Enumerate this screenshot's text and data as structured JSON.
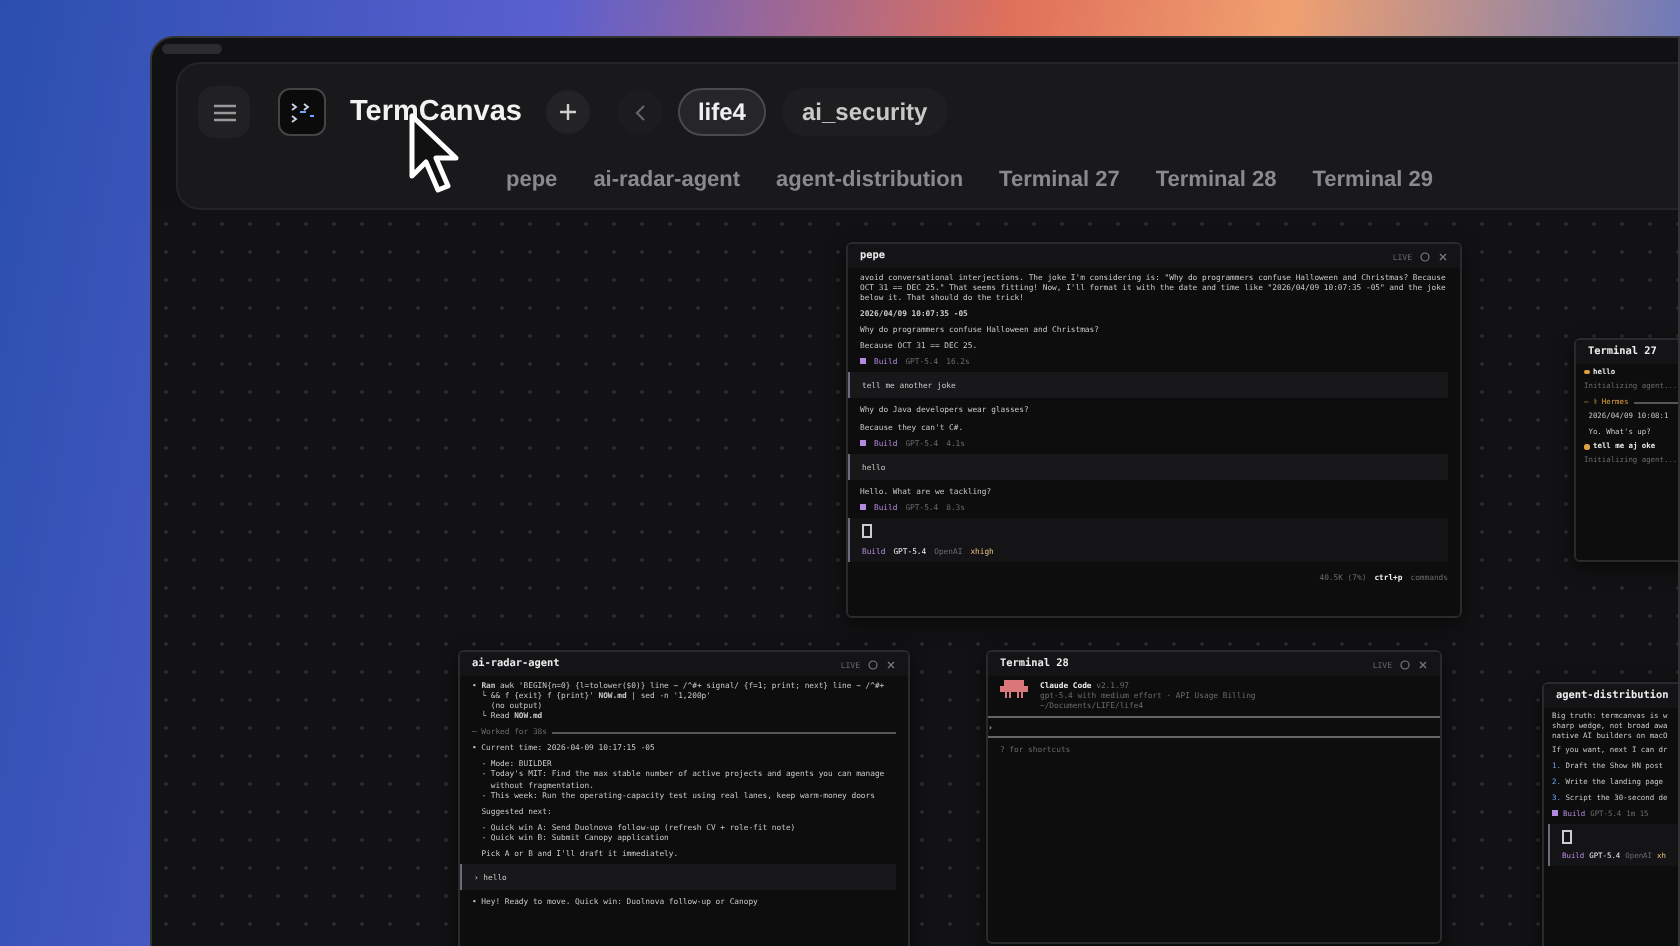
{
  "app": {
    "title": "TermCanvas"
  },
  "projects": [
    {
      "label": "life4",
      "selected": true
    },
    {
      "label": "ai_security",
      "selected": false
    }
  ],
  "terminal_tabs": [
    "pepe",
    "ai-radar-agent",
    "agent-distribution",
    "Terminal 27",
    "Terminal 28",
    "Terminal 29"
  ],
  "terminals": [
    {
      "title": "pepe",
      "status": "LIVE",
      "lines": [
        {
          "kind": "text",
          "text": "avoid conversational interjections. The joke I'm considering is: \"Why do programmers confuse Halloween and Christmas? Because OCT 31 == DEC 25.\" That seems fitting! Now, I'll format it with the date and time like \"2026/04/09 10:07:35 -05\" and the joke below it. That should do the trick!"
        },
        {
          "kind": "bold",
          "text": "2026/04/09 10:07:35 -05"
        },
        {
          "kind": "text",
          "text": "Why do programmers confuse Halloween and Christmas?"
        },
        {
          "kind": "text",
          "text": "Because OCT 31 == DEC 25."
        },
        {
          "kind": "meta",
          "mode": "Build",
          "model": "GPT-5.4",
          "time": "16.2s"
        },
        {
          "kind": "user",
          "text": "tell me another joke"
        },
        {
          "kind": "text",
          "text": "Why do Java developers wear glasses?"
        },
        {
          "kind": "text",
          "text": "Because they can't C#."
        },
        {
          "kind": "meta",
          "mode": "Build",
          "model": "GPT-5.4",
          "time": "4.1s"
        },
        {
          "kind": "user",
          "text": "hello"
        },
        {
          "kind": "text",
          "text": "Hello. What are we tackling?"
        },
        {
          "kind": "meta",
          "mode": "Build",
          "model": "GPT-5.4",
          "time": "8.3s"
        },
        {
          "kind": "input",
          "mode": "Build",
          "model": "GPT-5.4",
          "provider": "OpenAI",
          "effort": "xhigh"
        },
        {
          "kind": "status",
          "usage": "40.5K (7%)",
          "key": "ctrl+p",
          "action": "commands"
        }
      ]
    },
    {
      "title": "ai-radar-agent",
      "status": "LIVE",
      "lines": [
        {
          "kind": "text",
          "text": "• **Ran** awk 'BEGIN{n=0} {l=tolower($0)} line ~ /^#+ signal/ {f=1; print; next} line ~ /^#+\n  └ && f {exit} f {print}' **NOW.md** | sed -n '1,200p'\n    (no output)\n  └ Read **NOW.md**"
        },
        {
          "kind": "rule",
          "text": "─ Worked for 38s"
        },
        {
          "kind": "text",
          "text": "• Current time: 2026-04-09 10:17:15 -05"
        },
        {
          "kind": "text",
          "text": "  - Mode: BUILDER\n  - Today's MIT: Find the max stable number of active projects and agents you can manage\n    without fragmentation.\n  - This week: Run the operating-capacity test using real lanes, keep warm-money doors"
        },
        {
          "kind": "text",
          "text": "  Suggested next:"
        },
        {
          "kind": "text",
          "text": "  - Quick win A: Send Duolnova follow-up (refresh CV + role-fit note)\n  - Quick win B: Submit Canopy application"
        },
        {
          "kind": "text",
          "text": "  Pick A or B and I'll draft it immediately."
        },
        {
          "kind": "user",
          "text": "› hello"
        },
        {
          "kind": "text",
          "text": "• Hey! Ready to move. Quick win: Duolnova follow-up or Canopy"
        }
      ]
    },
    {
      "title": "Terminal 28",
      "status": "LIVE",
      "lines": [
        {
          "kind": "banner",
          "name": "Claude Code",
          "version": "v2.1.97",
          "detail": "gpt-5.4 with medium effort · API Usage Billing",
          "path": "~/Documents/LIFE/life4"
        },
        {
          "kind": "prompt",
          "text": "›"
        },
        {
          "kind": "hint",
          "text": "? for shortcuts"
        }
      ]
    },
    {
      "title": "Terminal 27",
      "lines": [
        {
          "kind": "dot",
          "text": "hello"
        },
        {
          "kind": "hint",
          "text": "Initializing agent..."
        },
        {
          "kind": "section",
          "text": "— ⚕ Hermes"
        },
        {
          "kind": "text",
          "text": " 2026/04/09 10:08:1"
        },
        {
          "kind": "text",
          "text": " Yo. What's up?"
        },
        {
          "kind": "dot",
          "text": "tell me aj oke"
        },
        {
          "kind": "hint",
          "text": "Initializing agent..."
        }
      ]
    },
    {
      "title": "agent-distribution",
      "lines": [
        {
          "kind": "text",
          "text": "Big truth: termcanvas is w\nsharp wedge, not broad awa\nnative AI builders on macO"
        },
        {
          "kind": "text",
          "text": "If you want, next I can dr"
        },
        {
          "kind": "item",
          "number": "1.",
          "text": "Draft the Show HN post"
        },
        {
          "kind": "item",
          "number": "2.",
          "text": "Write the landing page"
        },
        {
          "kind": "item",
          "number": "3.",
          "text": "Script the 30-second de"
        },
        {
          "kind": "meta",
          "mode": "Build",
          "model": "GPT-5.4",
          "time": "1m 15"
        },
        {
          "kind": "input",
          "mode": "Build",
          "model": "GPT-5.4",
          "provider": "OpenAI",
          "effort": "xh"
        }
      ]
    }
  ]
}
